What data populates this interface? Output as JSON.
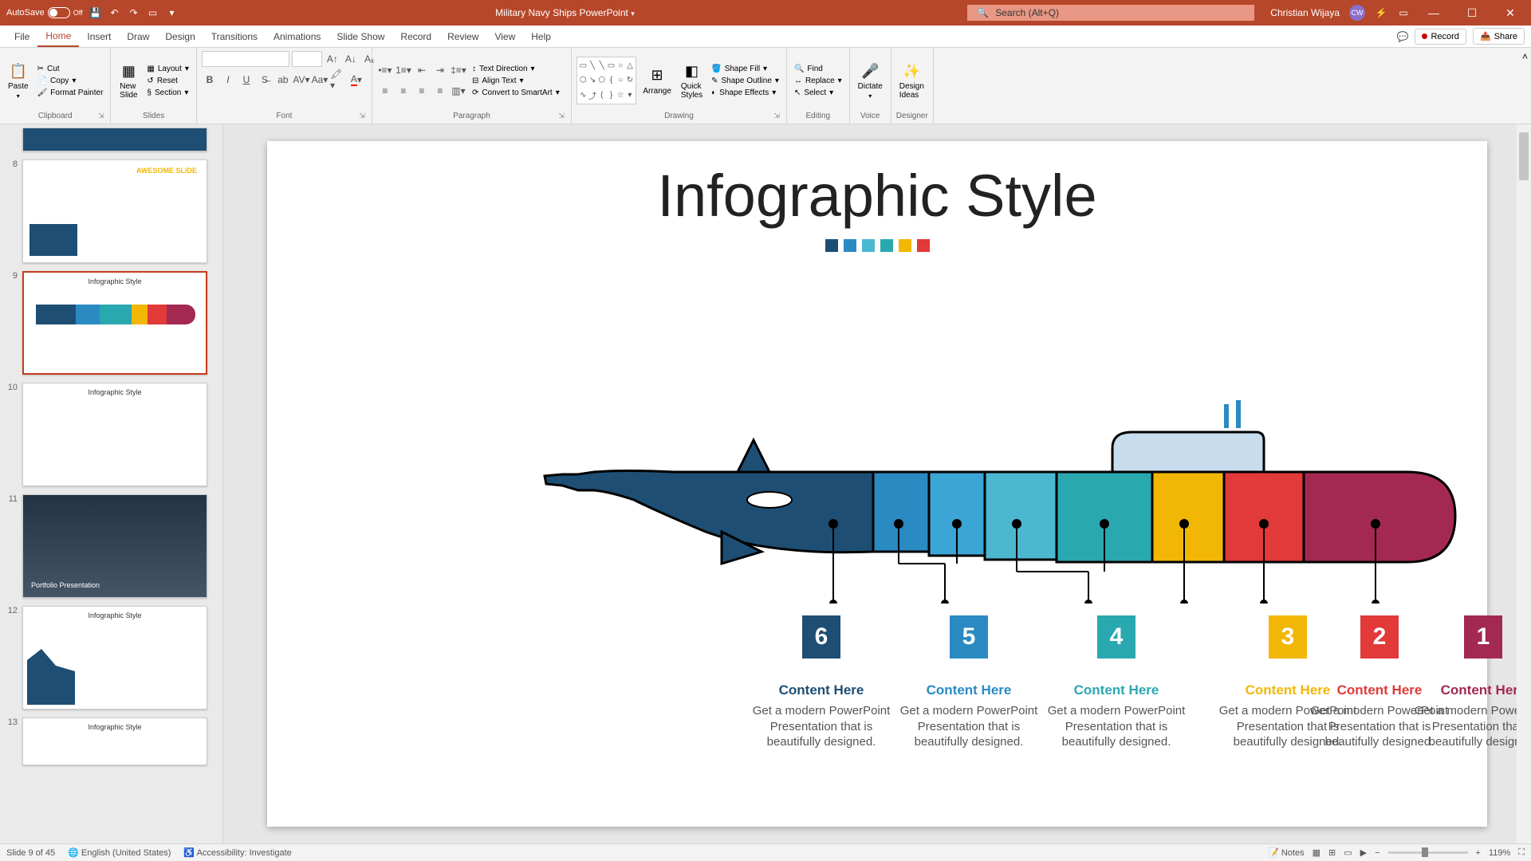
{
  "titlebar": {
    "autosave": "AutoSave",
    "doc_title": "Military Navy Ships PowerPoint",
    "search_placeholder": "Search (Alt+Q)",
    "user": "Christian Wijaya",
    "user_initials": "CW"
  },
  "tabs": {
    "file": "File",
    "home": "Home",
    "insert": "Insert",
    "draw": "Draw",
    "design": "Design",
    "transitions": "Transitions",
    "animations": "Animations",
    "slideshow": "Slide Show",
    "record": "Record",
    "review": "Review",
    "view": "View",
    "help": "Help",
    "record_btn": "Record",
    "share_btn": "Share"
  },
  "ribbon": {
    "clipboard": {
      "label": "Clipboard",
      "paste": "Paste",
      "cut": "Cut",
      "copy": "Copy",
      "painter": "Format Painter"
    },
    "slides": {
      "label": "Slides",
      "new": "New\nSlide",
      "layout": "Layout",
      "reset": "Reset",
      "section": "Section"
    },
    "font": {
      "label": "Font"
    },
    "paragraph": {
      "label": "Paragraph",
      "textdir": "Text Direction",
      "align": "Align Text",
      "smartart": "Convert to SmartArt"
    },
    "drawing": {
      "label": "Drawing",
      "arrange": "Arrange",
      "quick": "Quick\nStyles",
      "fill": "Shape Fill",
      "outline": "Shape Outline",
      "effects": "Shape Effects"
    },
    "editing": {
      "label": "Editing",
      "find": "Find",
      "replace": "Replace",
      "select": "Select"
    },
    "voice": {
      "label": "Voice",
      "dictate": "Dictate"
    },
    "designer": {
      "label": "Designer",
      "ideas": "Design\nIdeas"
    }
  },
  "thumbs": {
    "t8": "AWESOME SLIDE",
    "t9": "Infographic Style",
    "t10": "Infographic Style",
    "t11": "Portfolio Presentation",
    "t12": "Infographic Style",
    "t13": "Infographic Style"
  },
  "slide": {
    "title": "Infographic Style",
    "colors": [
      "#1e4e73",
      "#2a8ac2",
      "#4bb8d0",
      "#2aa8b0",
      "#f2b705",
      "#e23939",
      "#a32952"
    ],
    "callouts": [
      {
        "num": "6",
        "color": "#1e4e73",
        "head": "Content  Here",
        "body": "Get a modern PowerPoint Presentation that is beautifully designed."
      },
      {
        "num": "5",
        "color": "#2a8ac2",
        "head": "Content  Here",
        "body": "Get a modern PowerPoint Presentation that is beautifully designed."
      },
      {
        "num": "4",
        "color": "#2aa8b0",
        "head": "Content  Here",
        "body": "Get a modern PowerPoint Presentation that is beautifully designed."
      },
      {
        "num": "3",
        "color": "#f2b705",
        "head": "Content  Here",
        "body": "Get a modern PowerPoint Presentation that is beautifully designed."
      },
      {
        "num": "2",
        "color": "#e23939",
        "head": "Content  Here",
        "body": "Get a modern PowerPoint Presentation that is beautifully designed."
      },
      {
        "num": "1",
        "color": "#a32952",
        "head": "Content  Here",
        "body": "Get a modern PowerPoint Presentation that is beautifully designed."
      }
    ]
  },
  "status": {
    "slide": "Slide 9 of 45",
    "lang": "English (United States)",
    "access": "Accessibility: Investigate",
    "notes": "Notes",
    "zoom": "119%"
  }
}
